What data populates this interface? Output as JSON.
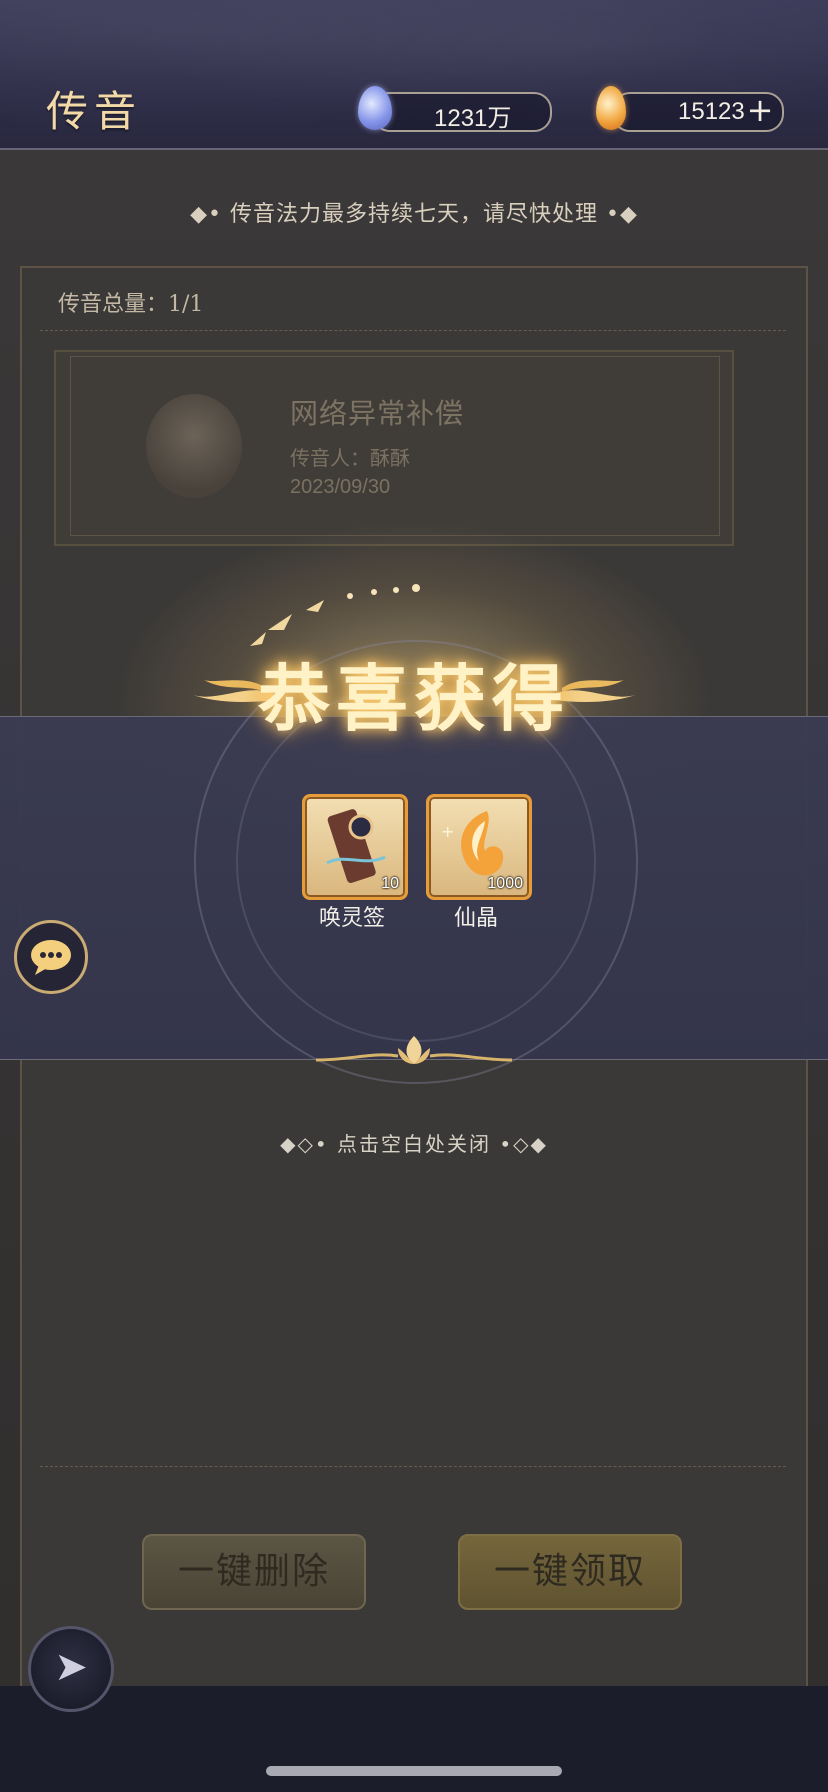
{
  "header": {
    "title": "传音",
    "currency_1": {
      "value": "1231万",
      "icon": "blue-crystal-icon"
    },
    "currency_2": {
      "value": "15123",
      "icon": "fire-crystal-icon",
      "add_label": "+"
    }
  },
  "notice": "◆• 传音法力最多持续七天，请尽快处理 •◆",
  "panel": {
    "total_label": "传音总量：1/1",
    "mail": {
      "title": "网络异常补偿",
      "sender": "传音人：酥酥",
      "date": "2023/09/30"
    },
    "buttons": {
      "delete_all": "一键删除",
      "claim_all": "一键领取"
    }
  },
  "reward": {
    "title": "恭喜获得",
    "items": [
      {
        "name": "唤灵签",
        "count": "10",
        "icon": "summon-tag-icon"
      },
      {
        "name": "仙晶",
        "count": "1000",
        "icon": "fire-crystal-icon"
      }
    ],
    "close_hint": "◆◇• 点击空白处关闭 •◇◆"
  },
  "colors": {
    "header_bg": "#2f2e4a",
    "gold_text": "#f2d9a7",
    "item_border": "#e79c3a",
    "overlay_band": "#3a3b52"
  }
}
